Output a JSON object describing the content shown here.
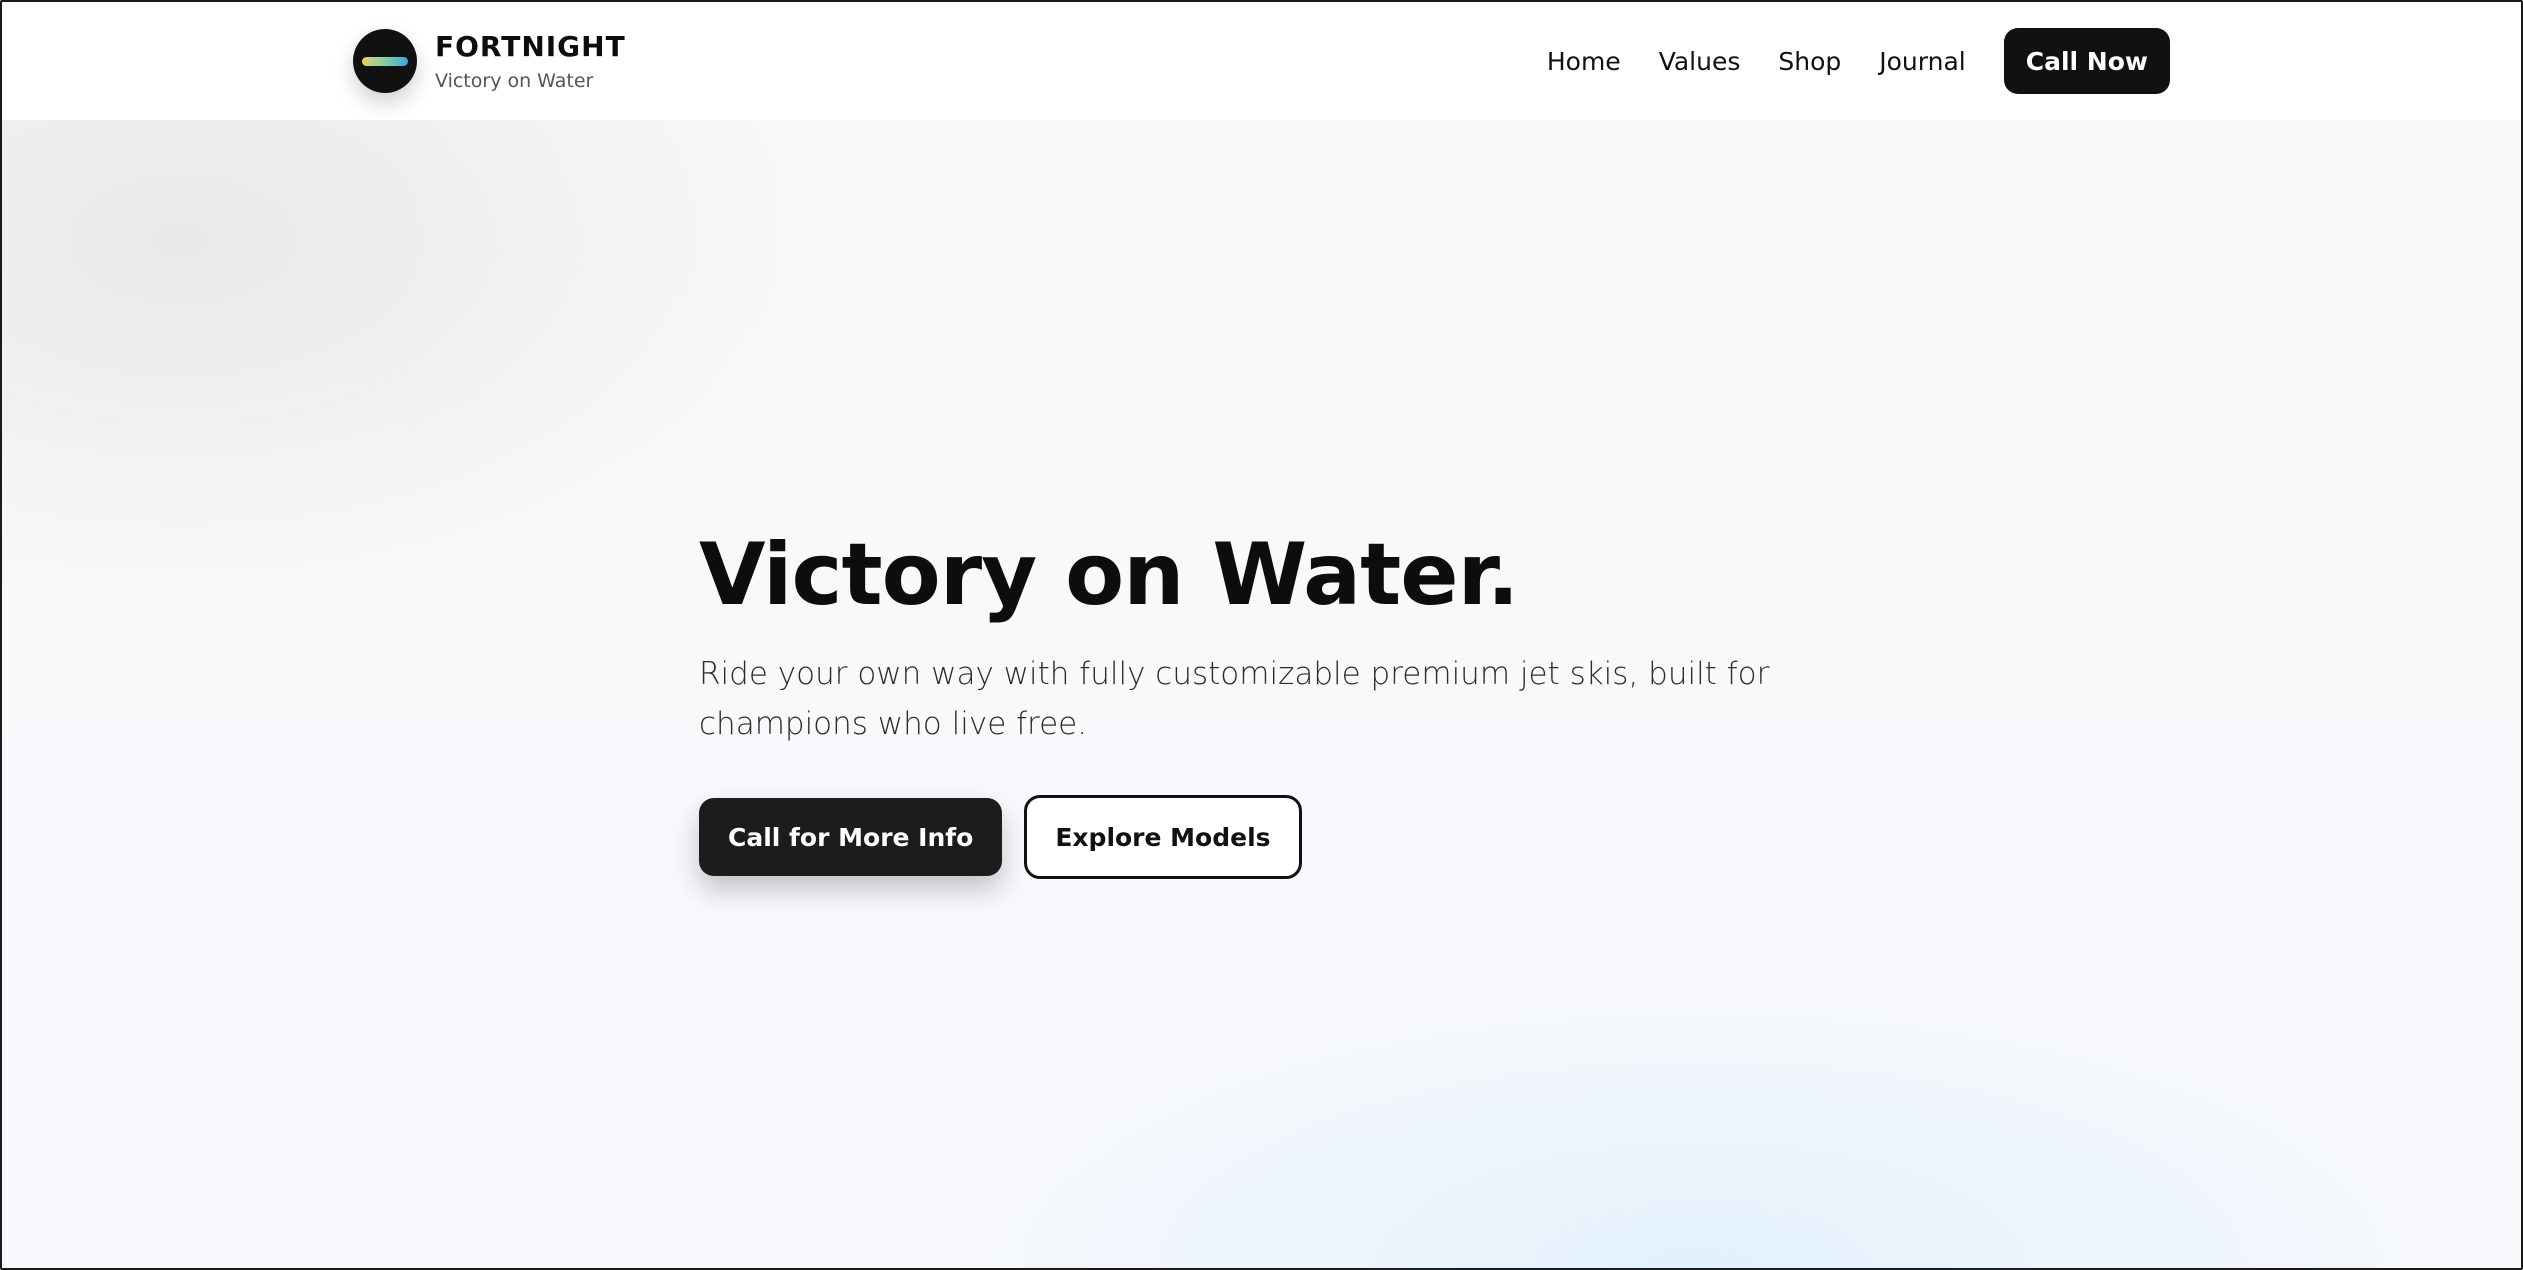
{
  "brand": {
    "name": "FORTNIGHT",
    "tagline": "Victory on Water",
    "logo_icon": "logo-bar-icon",
    "logo_gradient": [
      "#e6d36a",
      "#8fcf9e",
      "#3aa7e0"
    ]
  },
  "nav": {
    "items": [
      {
        "label": "Home"
      },
      {
        "label": "Values"
      },
      {
        "label": "Shop"
      },
      {
        "label": "Journal"
      }
    ],
    "cta_label": "Call Now"
  },
  "hero": {
    "title": "Victory on Water.",
    "subtitle": "Ride your own way with fully customizable premium jet skis, built for champions who live free.",
    "primary_label": "Call for More Info",
    "secondary_label": "Explore Models"
  },
  "colors": {
    "primary": "#111111",
    "background": "#f8f9fb",
    "text": "#0d0d0d"
  }
}
